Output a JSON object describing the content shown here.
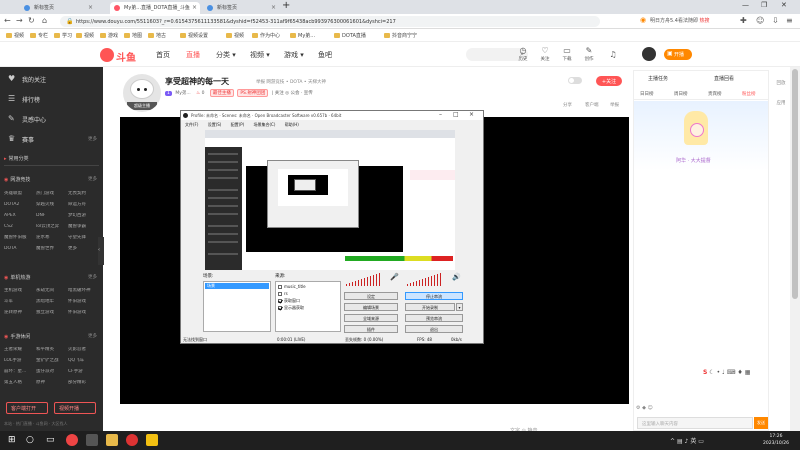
{
  "browser": {
    "tabs": [
      {
        "label": "新标签页"
      },
      {
        "label": "My弟...直播_DOTA直播_斗鱼"
      },
      {
        "label": "新标签页"
      }
    ],
    "url": "https://www.douyu.com/5511603?_r=0.6154375611133581&dyshid=f52453-311af9f65438acb993976300061601&dyshci=217",
    "search_hint": "明日方舟5.4看法随即",
    "search_hot": "热搜",
    "bookmarks": [
      "视频",
      "专栏",
      "学习",
      "视频",
      "游戏",
      "地图",
      "地古",
      "视频设置",
      "视频",
      "作为中心",
      "My弟...",
      "DOTA直播",
      "抖音商宁宁"
    ]
  },
  "site": {
    "logo": "斗鱼",
    "nav": [
      "首页",
      "直播",
      "分类 ▾",
      "视频 ▾",
      "游戏 ▾",
      "鱼吧"
    ],
    "header_icons": [
      {
        "icon": "history-icon",
        "label": "历史"
      },
      {
        "icon": "follow-icon",
        "label": "关注"
      },
      {
        "icon": "download-icon",
        "label": "下载"
      },
      {
        "icon": "create-icon",
        "label": "创作"
      }
    ],
    "open_live": "开播"
  },
  "sidebar": {
    "main": [
      {
        "icon": "heart-icon",
        "label": "我的关注"
      },
      {
        "icon": "list-icon",
        "label": "排行榜"
      },
      {
        "icon": "paint-icon",
        "label": "灵感中心"
      },
      {
        "icon": "trophy-icon",
        "label": "赛事"
      }
    ],
    "match_more": "更多",
    "commonly_used": "常用分类",
    "sections": [
      {
        "title": "网游竞技",
        "more": "更多",
        "items": [
          "英雄联盟",
          "热门游戏",
          "无畏契约",
          "DOTA2",
          "穿越火线",
          "命运方舟",
          "APEX",
          "DNF",
          "梦幻西游",
          "CS2",
          "lol云顶之弈",
          "魔兽争霸",
          "魔兽怀旧服",
          "逆水寒",
          "守望先锋",
          "DOTA",
          "魔兽世界",
          "更多"
        ]
      },
      {
        "title": "单机热游",
        "more": "更多",
        "items": [
          "主机游戏",
          "永劫无间",
          "暗黑破坏神",
          "斗军",
          "黑暗地牢",
          "怀旧游戏",
          "逆转原神",
          "独立游戏",
          "怀旧游戏"
        ]
      },
      {
        "title": "手游休闲",
        "more": "更多",
        "items": [
          "王者荣耀",
          "和平精英",
          "火影忍者",
          "LOL手游",
          "金铲铲之战",
          "QQ飞车",
          "崩坏：星...",
          "蛋仔派对",
          "CF手游",
          "第五人格",
          "原神",
          "部分精彩"
        ]
      }
    ],
    "btn_left": "客户端打开",
    "btn_right": "视频开播",
    "footer": "本站 · 热门直播 · 斗鱼网 · 大区找人"
  },
  "room": {
    "avatar_badge": "超级主播",
    "title": "享受超神的每一天",
    "meta": "举报  网游竞技 • DOTA • 天梯大神",
    "level_tag": "1",
    "streamer": "My弟...",
    "hot": "0",
    "tag1": "最佳主播",
    "tag2": "PS.射神团团",
    "sub_extra": "| 关注 ◎ 公会 · 宣传",
    "follow": "+关注",
    "actions": [
      "分享",
      "客户端",
      "举报"
    ]
  },
  "obs": {
    "title": "Profile: 未命名 · Scenes: 未命名 · Open Broadcaster Software v0.657b · 64bit",
    "menu": [
      "文件(F)",
      "设置(S)",
      "配置(P)",
      "场景集合(C)",
      "帮助(H)"
    ],
    "scenes_label": "场景:",
    "sources_label": "来源:",
    "scene_selected": "场景",
    "sources": [
      {
        "label": "music_title",
        "checked": false
      },
      {
        "label": "rs",
        "checked": false
      },
      {
        "label": "获取窗口",
        "checked": true
      },
      {
        "label": "显示器获取",
        "checked": true
      }
    ],
    "buttons": [
      {
        "label": "设定",
        "pressed": false
      },
      {
        "label": "停止串流",
        "pressed": true
      },
      {
        "label": "编辑场景",
        "pressed": false
      },
      {
        "label": "开始录制",
        "pressed": false
      },
      {
        "label": "全域来源",
        "pressed": false
      },
      {
        "label": "预览串流",
        "pressed": false
      },
      {
        "label": "插件",
        "pressed": false
      },
      {
        "label": "退出",
        "pressed": false
      }
    ],
    "status": {
      "left": "无法找到窗口",
      "time": "0:00:01 (LIVE)",
      "dropped": "丢失帧数: 0 (0.00%)",
      "fps": "FPS: 48",
      "rate": "0kb/s"
    }
  },
  "chat": {
    "top_left": "主播任务",
    "top_right": "直播回看",
    "tabs": [
      "日日榜",
      "周日榜",
      "贵宾榜",
      "粉丝榜"
    ],
    "banner_caption": "阿华 · 大大提督",
    "input_placeholder": "这里输入聊天内容",
    "send": "发送"
  },
  "player": {
    "bottom_text": "文字 ◎ 静音"
  },
  "right_strip": [
    "回放",
    "应用"
  ],
  "taskbar": {
    "time": "17:26",
    "date": "2023/10/26"
  },
  "colors": {
    "accent": "#ff5555",
    "orange": "#ff8800",
    "sidebar_bg": "#2b2b2b"
  }
}
